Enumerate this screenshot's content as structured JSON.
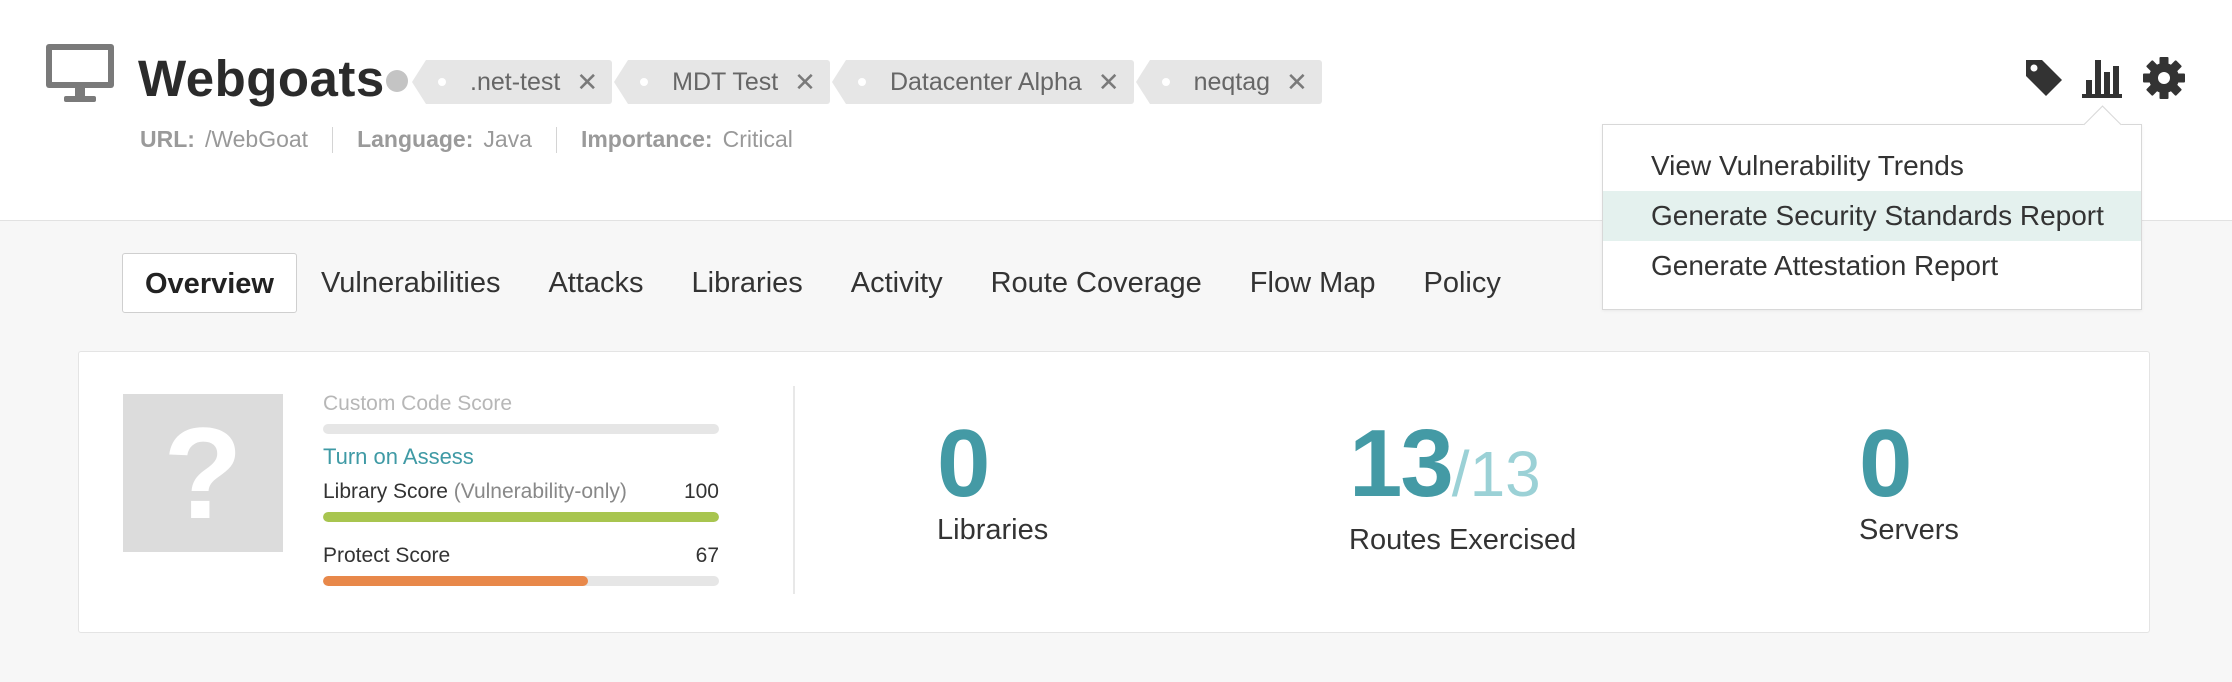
{
  "app": {
    "title": "Webgoats",
    "tags": [
      {
        "label": ".net-test"
      },
      {
        "label": "MDT Test"
      },
      {
        "label": "Datacenter Alpha"
      },
      {
        "label": "neqtag"
      }
    ],
    "meta": {
      "url_label": "URL:",
      "url_value": "/WebGoat",
      "language_label": "Language:",
      "language_value": "Java",
      "importance_label": "Importance:",
      "importance_value": "Critical"
    }
  },
  "toolbar": {
    "icons": [
      "tag-icon",
      "bar-chart-icon",
      "gear-icon"
    ]
  },
  "menu": {
    "items": [
      {
        "label": "View Vulnerability Trends",
        "active": false
      },
      {
        "label": "Generate Security Standards Report",
        "active": true
      },
      {
        "label": "Generate Attestation Report",
        "active": false
      }
    ]
  },
  "tabs": [
    {
      "label": "Overview",
      "active": true
    },
    {
      "label": "Vulnerabilities"
    },
    {
      "label": "Attacks"
    },
    {
      "label": "Libraries"
    },
    {
      "label": "Activity"
    },
    {
      "label": "Route Coverage"
    },
    {
      "label": "Flow Map"
    },
    {
      "label": "Policy"
    }
  ],
  "overview": {
    "grade_placeholder": "?",
    "custom_code": {
      "label": "Custom Code Score",
      "link": "Turn on Assess"
    },
    "library_score": {
      "label": "Library Score",
      "qualifier": "(Vulnerability-only)",
      "value": "100",
      "fraction": 1.0,
      "color": "#a8c54f"
    },
    "protect_score": {
      "label": "Protect Score",
      "value": "67",
      "fraction": 0.67,
      "color": "#e8884a"
    },
    "stats": [
      {
        "value": "0",
        "caption": "Libraries"
      },
      {
        "value": "13",
        "of": "/13",
        "caption": "Routes Exercised"
      },
      {
        "value": "0",
        "caption": "Servers"
      }
    ]
  },
  "colors": {
    "accent": "#449aa5",
    "accent_light": "#9bd1d6",
    "menu_highlight": "#e4f1ee"
  }
}
